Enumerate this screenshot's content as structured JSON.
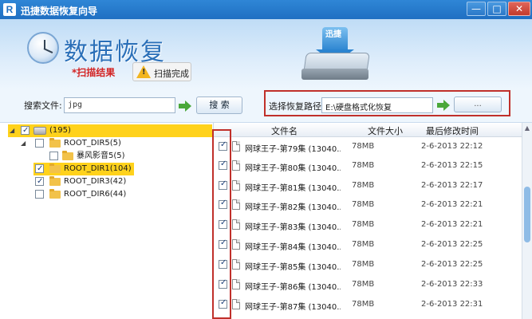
{
  "window": {
    "title": "迅捷数据恢复向导",
    "app_icon_letter": "R",
    "min_label": "—",
    "max_label": "□",
    "close_label": "✕"
  },
  "header": {
    "app_name": "数据恢复",
    "scan_result": "*扫描结果",
    "scan_done": "扫描完成",
    "hdd_label": "迅捷"
  },
  "search": {
    "label": "搜索文件:",
    "value": "jpg",
    "button": "搜 索",
    "path_label": "选择恢复路径",
    "path_value": "E:\\硬盘格式化恢复",
    "browse": "..."
  },
  "tree": {
    "items": [
      {
        "label": "(195)",
        "checked": true,
        "selected": true
      },
      {
        "label": "ROOT_DIR5(5)",
        "checked": false,
        "selected": false
      },
      {
        "label": "暴风影音5(5)",
        "checked": false,
        "selected": false
      },
      {
        "label": "ROOT_DIR1(104)",
        "checked": true,
        "selected": true
      },
      {
        "label": "ROOT_DIR3(42)",
        "checked": true,
        "selected": false
      },
      {
        "label": "ROOT_DIR6(44)",
        "checked": false,
        "selected": false
      }
    ]
  },
  "list": {
    "columns": [
      "文件名",
      "文件大小",
      "最后修改时间"
    ],
    "rows": [
      {
        "name": "网球王子-第79集 (13040...",
        "size": "78MB",
        "date": "2-6-2013 22:12",
        "checked": true
      },
      {
        "name": "网球王子-第80集 (13040...",
        "size": "78MB",
        "date": "2-6-2013 22:15",
        "checked": true
      },
      {
        "name": "网球王子-第81集 (13040...",
        "size": "78MB",
        "date": "2-6-2013 22:17",
        "checked": true
      },
      {
        "name": "网球王子-第82集 (13040...",
        "size": "78MB",
        "date": "2-6-2013 22:21",
        "checked": true
      },
      {
        "name": "网球王子-第83集 (13040...",
        "size": "78MB",
        "date": "2-6-2013 22:21",
        "checked": true
      },
      {
        "name": "网球王子-第84集 (13040...",
        "size": "78MB",
        "date": "2-6-2013 22:25",
        "checked": true
      },
      {
        "name": "网球王子-第85集 (13040...",
        "size": "78MB",
        "date": "2-6-2013 22:25",
        "checked": true
      },
      {
        "name": "网球王子-第86集 (13040...",
        "size": "78MB",
        "date": "2-6-2013 22:33",
        "checked": true
      },
      {
        "name": "网球王子-第87集 (13040...",
        "size": "78MB",
        "date": "2-6-2013 22:31",
        "checked": true
      }
    ]
  },
  "colors": {
    "titlebar": "#1f6fc2",
    "highlight": "#ffd21c",
    "annotation_red": "#c0302a",
    "scan_result_red": "#d32424"
  }
}
